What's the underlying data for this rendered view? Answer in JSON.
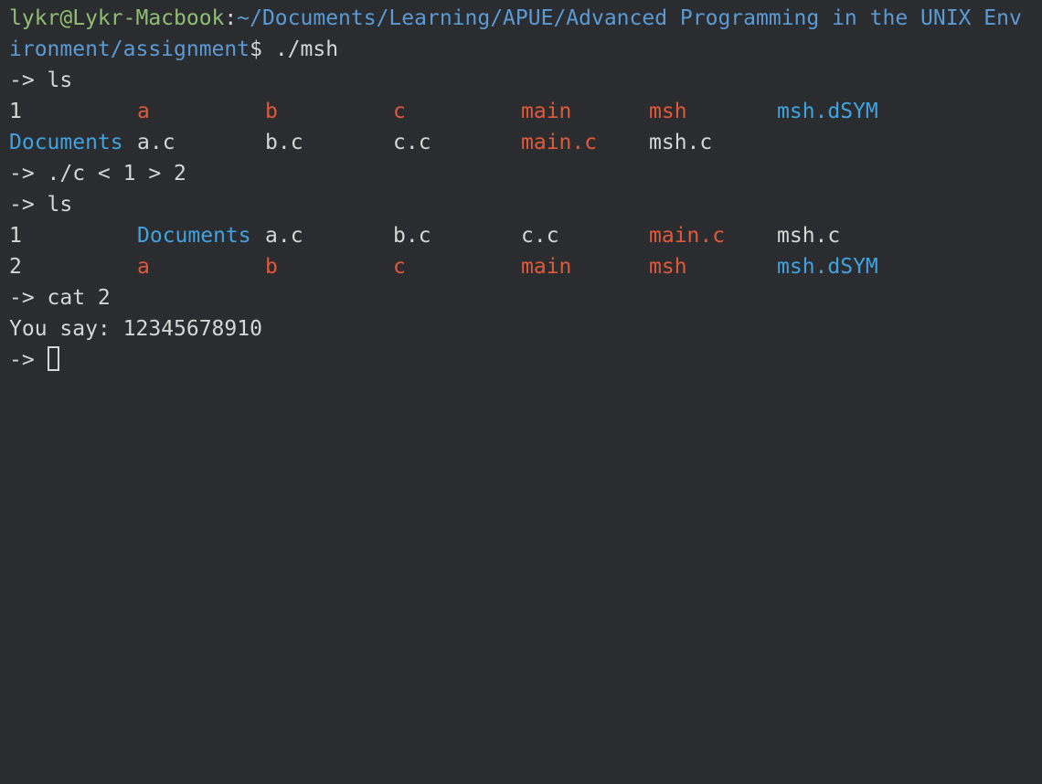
{
  "prompt": {
    "user_host": "lykr@Lykr-Macbook",
    "separator": ":",
    "path_line1": "~/Documents/Learning/APUE/Advanced Programming in the UNIX Env",
    "path_line2": "ironment/assignment",
    "dollar": "$ ",
    "command": "./msh"
  },
  "shell_prompt": "-> ",
  "commands": {
    "ls_first": "ls",
    "redirect": "./c < 1 > 2",
    "ls_second": "ls",
    "cat": "cat 2",
    "current": ""
  },
  "listing1": {
    "row1": [
      {
        "text": "1",
        "kind": "file"
      },
      {
        "text": "a",
        "kind": "exec"
      },
      {
        "text": "b",
        "kind": "exec"
      },
      {
        "text": "c",
        "kind": "exec"
      },
      {
        "text": "main",
        "kind": "exec"
      },
      {
        "text": "msh",
        "kind": "exec"
      },
      {
        "text": "msh.dSYM",
        "kind": "dir"
      }
    ],
    "row2": [
      {
        "text": "Documents",
        "kind": "dir"
      },
      {
        "text": "a.c",
        "kind": "file"
      },
      {
        "text": "b.c",
        "kind": "file"
      },
      {
        "text": "c.c",
        "kind": "file"
      },
      {
        "text": "main.c",
        "kind": "exec"
      },
      {
        "text": "msh.c",
        "kind": "file"
      }
    ]
  },
  "listing2": {
    "row1": [
      {
        "text": "1",
        "kind": "file"
      },
      {
        "text": "Documents",
        "kind": "dir"
      },
      {
        "text": "a.c",
        "kind": "file"
      },
      {
        "text": "b.c",
        "kind": "file"
      },
      {
        "text": "c.c",
        "kind": "file"
      },
      {
        "text": "main.c",
        "kind": "exec"
      },
      {
        "text": "msh.c",
        "kind": "file"
      }
    ],
    "row2": [
      {
        "text": "2",
        "kind": "file"
      },
      {
        "text": "a",
        "kind": "exec"
      },
      {
        "text": "b",
        "kind": "exec"
      },
      {
        "text": "c",
        "kind": "exec"
      },
      {
        "text": "main",
        "kind": "exec"
      },
      {
        "text": "msh",
        "kind": "exec"
      },
      {
        "text": "msh.dSYM",
        "kind": "dir"
      }
    ]
  },
  "output": {
    "cat_result": "You say: 12345678910"
  },
  "colors": {
    "background": "#2b2c2f",
    "text": "#d6d6d6",
    "user_host": "#8fbf73",
    "path": "#5a9bd5",
    "executable": "#e0593a",
    "directory": "#3ea3e0"
  }
}
